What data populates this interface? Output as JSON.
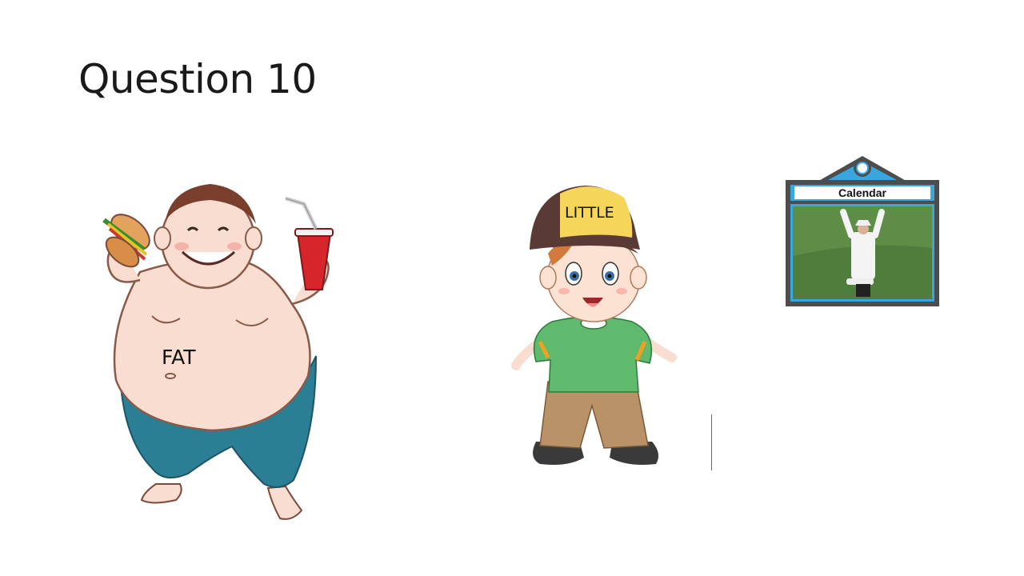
{
  "slide": {
    "title": "Question 10"
  },
  "pictures": {
    "fat_label": "FAT",
    "little_label": "LITTLE",
    "calendar_label": "Calendar"
  },
  "colors": {
    "skin": "#f9ddd0",
    "shorts": "#2a7f95",
    "cup": "#d7262b",
    "cap_yellow": "#f6d65a",
    "cap_brown": "#5a3a34",
    "shirt": "#5fba6e",
    "pants": "#b99267",
    "calendar_frame": "#4d4d4d",
    "calendar_accent": "#39a7de",
    "grass": "#4f7d3c"
  }
}
